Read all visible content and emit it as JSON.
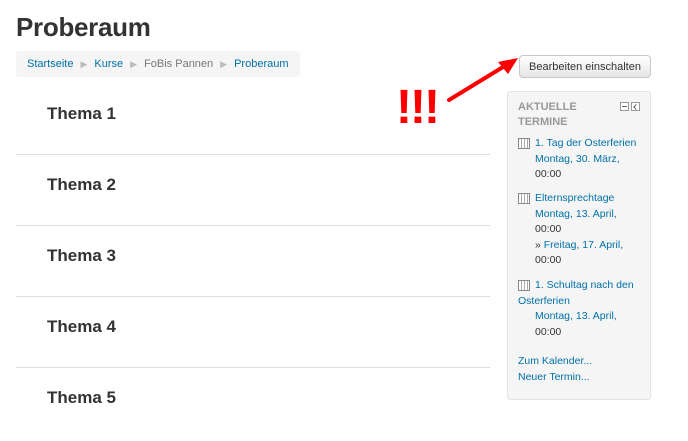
{
  "page": {
    "title": "Proberaum"
  },
  "breadcrumb": [
    {
      "label": "Startseite",
      "link": true
    },
    {
      "label": "Kurse",
      "link": true
    },
    {
      "label": "FoBis Pannen",
      "link": false
    },
    {
      "label": "Proberaum",
      "link": true
    }
  ],
  "edit_button": {
    "label": "Bearbeiten einschalten"
  },
  "annotation": {
    "text": "!!!"
  },
  "topics": [
    "Thema 1",
    "Thema 2",
    "Thema 3",
    "Thema 4",
    "Thema 5"
  ],
  "block": {
    "title_line1": "AKTUELLE",
    "title_line2": "TERMINE",
    "events": [
      {
        "name": "1. Tag der Osterferien",
        "date": "Montag, 30. März,",
        "time": "00:00"
      },
      {
        "name": "Elternsprechtage",
        "date": "Montag, 13. April,",
        "time": "00:00",
        "end_prefix": "»",
        "end_date": "Freitag, 17. April,",
        "end_time": "00:00"
      },
      {
        "name_line1": "1. Schultag nach den",
        "name_line2": "Osterferien",
        "date": "Montag, 13. April,",
        "time": "00:00"
      }
    ],
    "calendar_link": "Zum Kalender...",
    "new_event_link": "Neuer Termin..."
  }
}
